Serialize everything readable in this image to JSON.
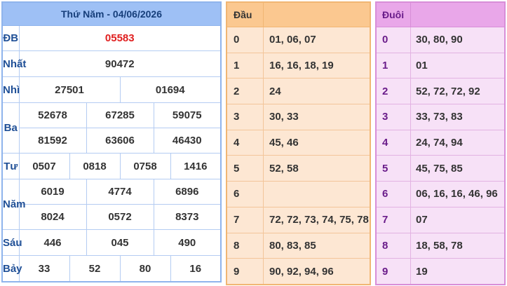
{
  "results": {
    "title": "Thứ Năm - 04/06/2026",
    "prizes": {
      "db": {
        "label": "ĐB",
        "numbers": [
          "05583"
        ]
      },
      "nhat": {
        "label": "Nhất",
        "numbers": [
          "90472"
        ]
      },
      "nhi": {
        "label": "Nhì",
        "numbers": [
          "27501",
          "01694"
        ]
      },
      "ba": {
        "label": "Ba",
        "numbers": [
          "52678",
          "67285",
          "59075",
          "81592",
          "63606",
          "46430"
        ]
      },
      "tu": {
        "label": "Tư",
        "numbers": [
          "0507",
          "0818",
          "0758",
          "1416"
        ]
      },
      "nam": {
        "label": "Năm",
        "numbers": [
          "6019",
          "4774",
          "6896",
          "8024",
          "0572",
          "8373"
        ]
      },
      "sau": {
        "label": "Sáu",
        "numbers": [
          "446",
          "045",
          "490"
        ]
      },
      "bay": {
        "label": "Bảy",
        "numbers": [
          "33",
          "52",
          "80",
          "16"
        ]
      }
    },
    "special_color": "#e02020"
  },
  "dau": {
    "header_key": "Đầu",
    "header_value": "",
    "rows": [
      {
        "k": "0",
        "v": "01, 06, 07"
      },
      {
        "k": "1",
        "v": "16, 16, 18, 19"
      },
      {
        "k": "2",
        "v": "24"
      },
      {
        "k": "3",
        "v": "30, 33"
      },
      {
        "k": "4",
        "v": "45, 46"
      },
      {
        "k": "5",
        "v": "52, 58"
      },
      {
        "k": "6",
        "v": ""
      },
      {
        "k": "7",
        "v": "72, 72, 73, 74, 75, 78"
      },
      {
        "k": "8",
        "v": "80, 83, 85"
      },
      {
        "k": "9",
        "v": "90, 92, 94, 96"
      }
    ]
  },
  "duoi": {
    "header_key": "Đuôi",
    "header_value": "",
    "rows": [
      {
        "k": "0",
        "v": "30, 80, 90"
      },
      {
        "k": "1",
        "v": "01"
      },
      {
        "k": "2",
        "v": "52, 72, 72, 92"
      },
      {
        "k": "3",
        "v": "33, 73, 83"
      },
      {
        "k": "4",
        "v": "24, 74, 94"
      },
      {
        "k": "5",
        "v": "45, 75, 85"
      },
      {
        "k": "6",
        "v": "06, 16, 16, 46, 96"
      },
      {
        "k": "7",
        "v": "07"
      },
      {
        "k": "8",
        "v": "18, 58, 78"
      },
      {
        "k": "9",
        "v": "19"
      }
    ]
  },
  "colors": {
    "results_header": "#9ec0f5",
    "dau_header": "#fbc890",
    "dau_body": "#fde7d3",
    "duoi_header": "#e9a7e9",
    "duoi_body": "#f7e1f7"
  }
}
